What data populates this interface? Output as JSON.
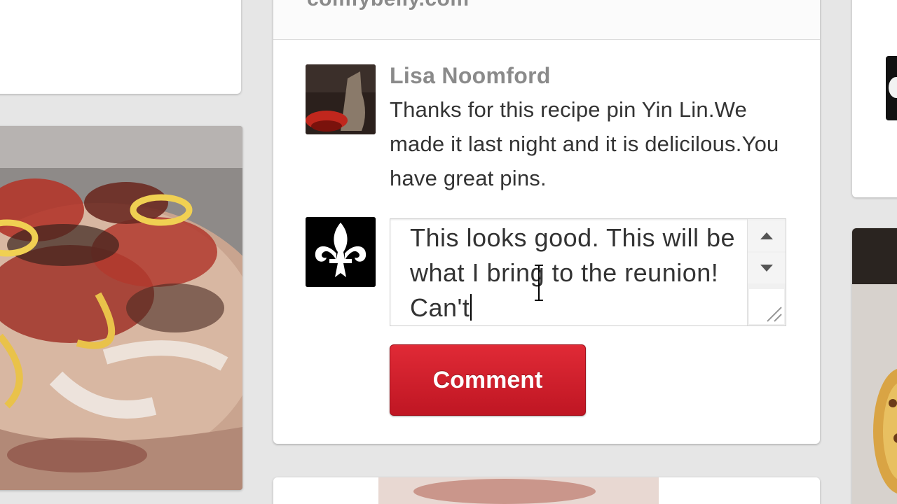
{
  "main_pin": {
    "source_domain": "comfybelly.com",
    "comments": [
      {
        "author": "Lisa Noomford",
        "text": "Thanks for this recipe pin Yin Lin.We made it last night and it is delicilous.You have great pins."
      }
    ],
    "new_comment": {
      "value": "This looks good. This will be what I bring to the reunion! Can't",
      "button_label": "Comment"
    }
  },
  "colors": {
    "comment_button": "#cc1f2d",
    "author_name": "#8a8a8a",
    "comment_text": "#333333"
  },
  "icons": {
    "user_avatar": "fleur-de-lis-icon",
    "scroll_up": "triangle-up-icon",
    "scroll_down": "triangle-down-icon",
    "resize": "resize-grip-icon"
  }
}
